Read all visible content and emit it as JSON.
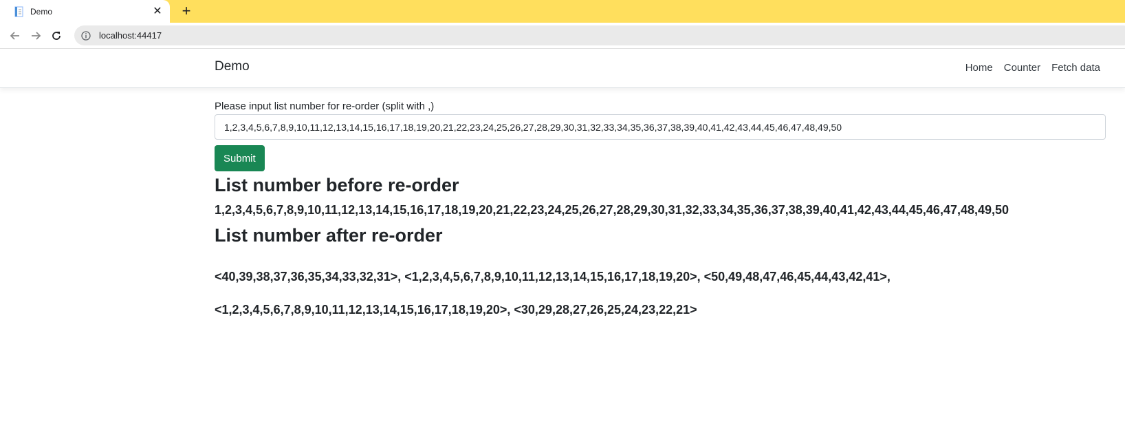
{
  "browser": {
    "tab": {
      "title": "Demo",
      "favicon": "document-icon"
    },
    "url": "localhost:44417",
    "accent_color": "#ffdf5d"
  },
  "app": {
    "brand": "Demo",
    "nav": [
      {
        "label": "Home"
      },
      {
        "label": "Counter"
      },
      {
        "label": "Fetch data"
      }
    ]
  },
  "form": {
    "label": "Please input list number for re-order (split with ,)",
    "input_value": "1,2,3,4,5,6,7,8,9,10,11,12,13,14,15,16,17,18,19,20,21,22,23,24,25,26,27,28,29,30,31,32,33,34,35,36,37,38,39,40,41,42,43,44,45,46,47,48,49,50",
    "submit_label": "Submit",
    "submit_color": "#198754"
  },
  "results": {
    "before_heading": "List number before re-order",
    "before_text": "1,2,3,4,5,6,7,8,9,10,11,12,13,14,15,16,17,18,19,20,21,22,23,24,25,26,27,28,29,30,31,32,33,34,35,36,37,38,39,40,41,42,43,44,45,46,47,48,49,50",
    "after_heading": "List number after re-order",
    "after_line1": "<40,39,38,37,36,35,34,33,32,31>, <1,2,3,4,5,6,7,8,9,10,11,12,13,14,15,16,17,18,19,20>, <50,49,48,47,46,45,44,43,42,41>,",
    "after_line2": "<1,2,3,4,5,6,7,8,9,10,11,12,13,14,15,16,17,18,19,20>, <30,29,28,27,26,25,24,23,22,21>"
  }
}
